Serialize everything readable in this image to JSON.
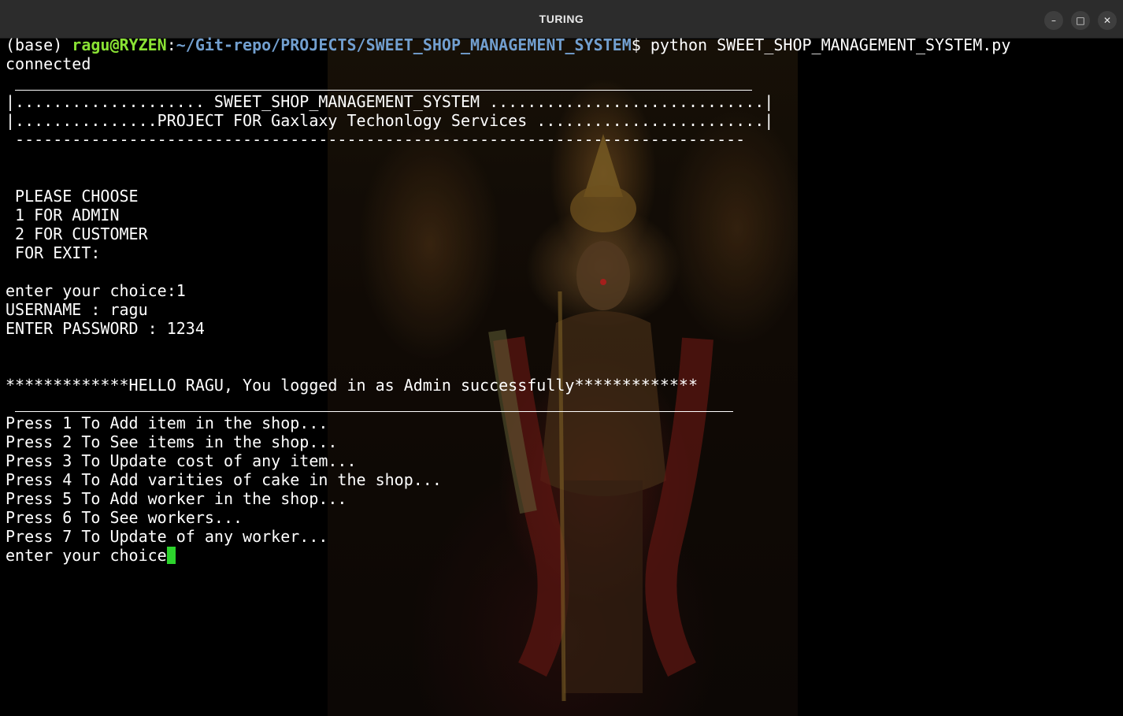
{
  "window": {
    "title": "TURING",
    "controls": {
      "minimize": "–",
      "maximize": "□",
      "close": "✕"
    }
  },
  "terminal": {
    "prompt": {
      "env": "(base) ",
      "user_host": "ragu@RYZEN",
      "colon": ":",
      "path": "~/Git-repo/PROJECTS/SWEET_SHOP_MANAGEMENT_SYSTEM",
      "symbol": "$ ",
      "command": "python SWEET_SHOP_MANAGEMENT_SYSTEM.py"
    },
    "connected": "connected",
    "banner_line1": "|.................... SWEET_SHOP_MANAGEMENT_SYSTEM .............................|",
    "banner_line2": "|...............PROJECT FOR Gaxlaxy Techonlogy Services ........................|",
    "banner_bottom": " -----------------------------------------------------------------------------",
    "menu_heading": " PLEASE CHOOSE",
    "menu_option_1": " 1 FOR ADMIN",
    "menu_option_2": " 2 FOR CUSTOMER",
    "menu_exit": " FOR EXIT:",
    "choice_entry": "enter your choice:1",
    "username_entry": "USERNAME : ragu",
    "password_entry": "ENTER PASSWORD : 1234",
    "login_success": "*************HELLO RAGU, You logged in as Admin successfully*************",
    "admin_options": [
      "Press 1 To Add item in the shop...",
      "Press 2 To See items in the shop...",
      "Press 3 To Update cost of any item...",
      "Press 4 To Add varities of cake in the shop...",
      "Press 5 To Add worker in the shop...",
      "Press 6 To See workers...",
      "Press 7 To Update of any worker..."
    ],
    "input_prompt": "enter your choice"
  },
  "colors": {
    "titlebar": "#2c2c2c",
    "terminal_bg": "#000000",
    "text": "#ffffff",
    "prompt_user": "#8ae234",
    "prompt_path": "#729fcf",
    "cursor": "#2dd42d"
  }
}
